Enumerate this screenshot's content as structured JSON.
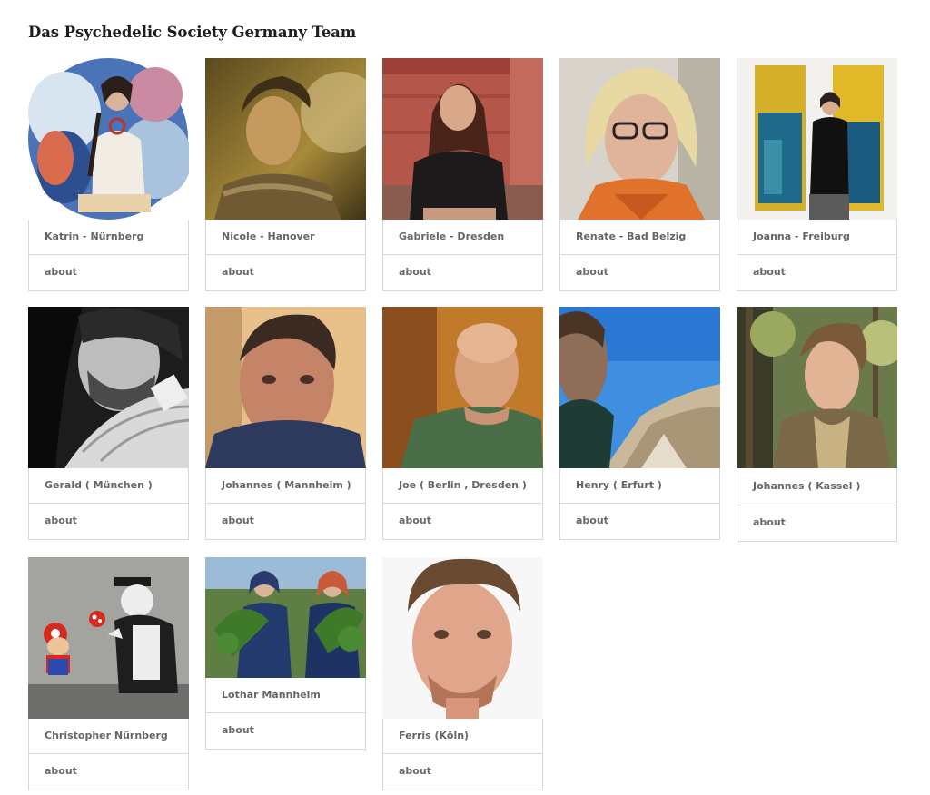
{
  "page": {
    "title": "Das Psychedelic Society Germany Team"
  },
  "members": [
    {
      "name": "Katrin - Nürnberg",
      "link": "about",
      "photo": "portrait-woman-meditating-psychedelic-art"
    },
    {
      "name": "Nicole - Hanover",
      "link": "about",
      "photo": "portrait-woman-golden-light"
    },
    {
      "name": "Gabriele - Dresden",
      "link": "about",
      "photo": "portrait-woman-red-brick-wall"
    },
    {
      "name": "Renate - Bad Belzig",
      "link": "about",
      "photo": "portrait-woman-glasses-orange-scarf"
    },
    {
      "name": "Joanna - Freiburg",
      "link": "about",
      "photo": "portrait-woman-abstract-paintings"
    },
    {
      "name": "Gerald ( München )",
      "link": "about",
      "photo": "portrait-man-guitar-bw"
    },
    {
      "name": "Johannes ( Mannheim )",
      "link": "about",
      "photo": "portrait-man-selfie-warm"
    },
    {
      "name": "Joe ( Berlin , Dresden )",
      "link": "about",
      "photo": "portrait-man-bald-green-shirt"
    },
    {
      "name": "Henry ( Erfurt )",
      "link": "about",
      "photo": "portrait-man-mountain-sky"
    },
    {
      "name": "Johannes ( Kassel )",
      "link": "about",
      "photo": "portrait-man-forest"
    },
    {
      "name": "Christopher Nürnberg",
      "link": "about",
      "photo": "street-art-mario-mushroom"
    },
    {
      "name": "Lothar Mannheim",
      "link": "about",
      "photo": "two-women-holding-plants"
    },
    {
      "name": "Ferris (Köln)",
      "link": "about",
      "photo": "portrait-man-white-background"
    }
  ]
}
